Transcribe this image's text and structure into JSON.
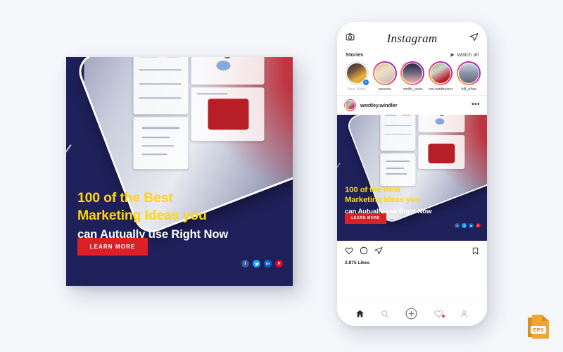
{
  "background_color": "#f4f6fa",
  "banner": {
    "bg_color": "#1e2059",
    "headline_color": "#ffd60a",
    "headline_line1": "100 of the Best",
    "headline_line2": "Marketing Ideas you",
    "subheadline": "can Autually use Right Now",
    "cta_label": "LEARN MORE",
    "cta_color": "#dd1f26",
    "social": [
      {
        "name": "facebook",
        "glyph": "f",
        "color": "#3b5998"
      },
      {
        "name": "twitter",
        "glyph": "t",
        "color": "#1da1f2"
      },
      {
        "name": "linkedin",
        "glyph": "in",
        "color": "#0a66c2"
      },
      {
        "name": "pinterest",
        "glyph": "P",
        "color": "#e60023"
      }
    ]
  },
  "phone": {
    "topbar": {
      "camera_icon": "camera-icon",
      "logo": "Instagram",
      "send_icon": "paper-plane-icon"
    },
    "stories": {
      "label": "Stories",
      "watch_all": "Watch all",
      "play_icon": "play-triangle-icon",
      "items": [
        {
          "name": "Your Story",
          "own": true,
          "add_badge": "+"
        },
        {
          "name": "pouros",
          "own": false
        },
        {
          "name": "smith_oran",
          "own": false
        },
        {
          "name": "rex.wintheiser",
          "own": false
        },
        {
          "name": "hill_eliza",
          "own": false
        }
      ]
    },
    "post": {
      "username": "westley.windler",
      "more_icon": "ellipsis-icon",
      "creative": {
        "headline_line1": "100 of the Best",
        "headline_line2": "Marketing Ideas you",
        "subheadline": "can Autually use Right Now",
        "cta_label": "LEARN MORE"
      },
      "actions": {
        "like_icon": "heart-outline-icon",
        "comment_icon": "comment-outline-icon",
        "share_icon": "paper-plane-outline-icon",
        "save_icon": "bookmark-outline-icon"
      },
      "likes": "2.875 Likes"
    },
    "nav": [
      {
        "name": "home",
        "icon": "home-icon",
        "active": true
      },
      {
        "name": "search",
        "icon": "search-icon",
        "active": false
      },
      {
        "name": "add",
        "icon": "plus-circle-icon",
        "active": false
      },
      {
        "name": "activity",
        "icon": "heart-icon",
        "active": false,
        "dot": true
      },
      {
        "name": "profile",
        "icon": "person-icon",
        "active": false
      }
    ]
  },
  "eps_badge": {
    "label": "EPS",
    "color": "#e8a02a"
  }
}
